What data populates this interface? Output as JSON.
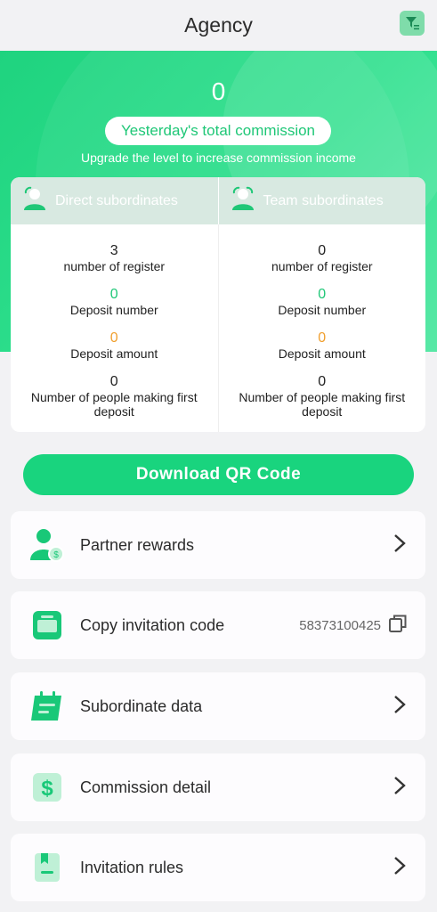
{
  "header": {
    "title": "Agency",
    "filter_icon": "filter-icon"
  },
  "hero": {
    "amount": "0",
    "pill": "Yesterday's total commission",
    "subtitle": "Upgrade the level to increase commission income"
  },
  "subordinates": {
    "direct": {
      "title": "Direct subordinates",
      "register_value": "3",
      "register_label": "number of register",
      "deposit_number_value": "0",
      "deposit_number_label": "Deposit number",
      "deposit_amount_value": "0",
      "deposit_amount_label": "Deposit amount",
      "first_deposit_value": "0",
      "first_deposit_label": "Number of people making first deposit"
    },
    "team": {
      "title": "Team subordinates",
      "register_value": "0",
      "register_label": "number of register",
      "deposit_number_value": "0",
      "deposit_number_label": "Deposit number",
      "deposit_amount_value": "0",
      "deposit_amount_label": "Deposit amount",
      "first_deposit_value": "0",
      "first_deposit_label": "Number of people making first deposit"
    }
  },
  "qr_button": "Download QR Code",
  "menu": {
    "partner_rewards": "Partner rewards",
    "copy_invitation_code": "Copy invitation code",
    "invitation_code": "58373100425",
    "subordinate_data": "Subordinate data",
    "commission_detail": "Commission detail",
    "invitation_rules": "Invitation rules"
  },
  "colors": {
    "accent": "#19d47e",
    "orange": "#f0a030",
    "icon_bg": "#7fdcaa"
  }
}
